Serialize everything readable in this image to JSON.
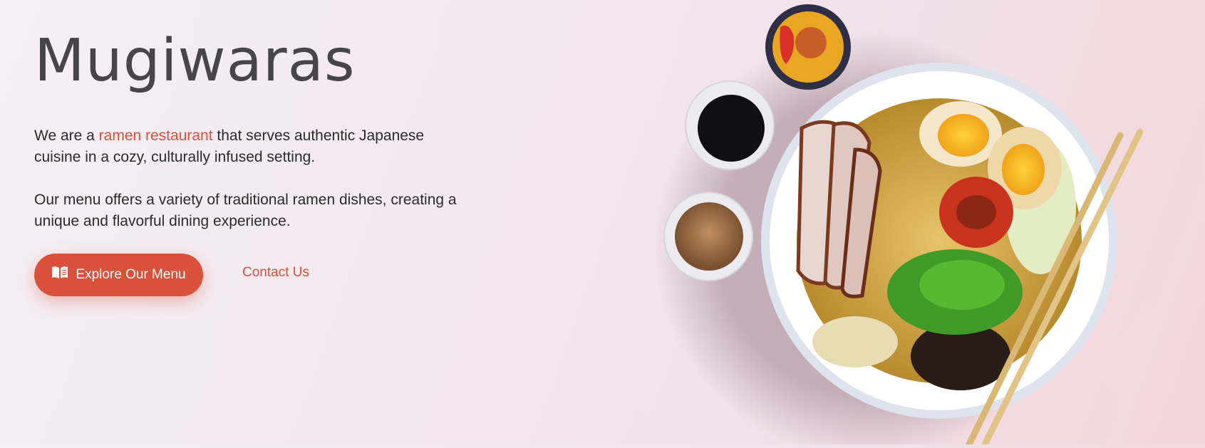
{
  "hero": {
    "title": "Mugiwaras",
    "intro_before": "We are a ",
    "intro_highlight": "ramen restaurant",
    "intro_after": " that serves authentic Japanese cuisine in a cozy, culturally infused setting.",
    "menu_description": "Our menu offers a variety of traditional ramen dishes, creating a unique and flavorful dining experience."
  },
  "actions": {
    "primary_label": "Explore Our Menu",
    "primary_icon": "open-book-icon",
    "secondary_label": "Contact Us"
  },
  "colors": {
    "accent": "#d9513b",
    "title_text": "#474547",
    "body_text": "#2b2b2b"
  }
}
